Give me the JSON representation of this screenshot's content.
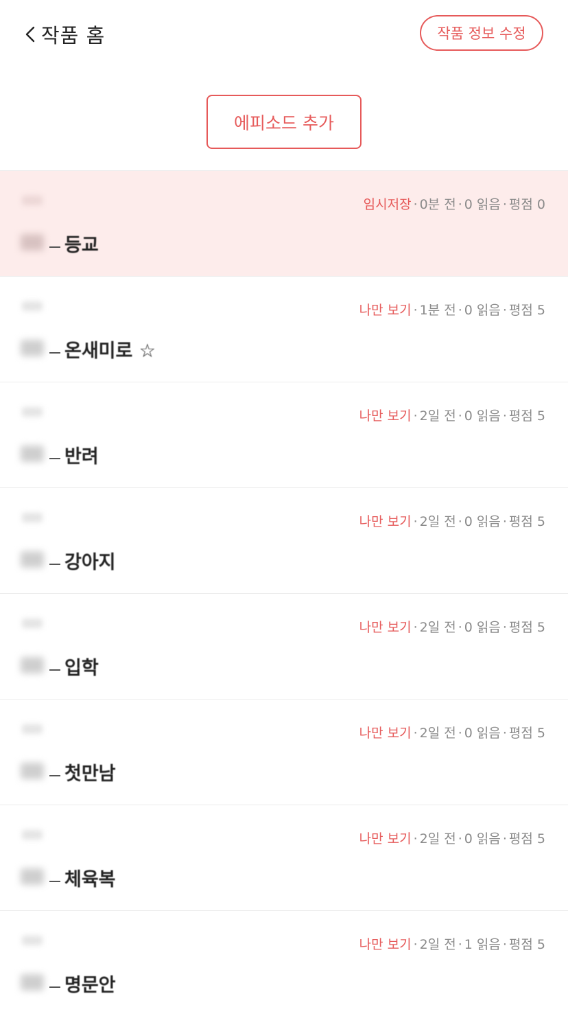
{
  "header": {
    "back_label": "작품 홈",
    "edit_info_label": "작품 정보 수정"
  },
  "actions": {
    "add_episode_label": "에피소드 추가"
  },
  "colors": {
    "accent": "#e65a5a",
    "highlight_bg": "#fdeceb",
    "meta_gray": "#8a8a8a"
  },
  "episodes": [
    {
      "title": "등교",
      "status": "임시저장",
      "time": "0분 전",
      "reads": "0 읽음",
      "rating": "평점 0"
    },
    {
      "title": "온새미로 ☆",
      "status": "나만 보기",
      "time": "1분 전",
      "reads": "0 읽음",
      "rating": "평점 5"
    },
    {
      "title": "반려",
      "status": "나만 보기",
      "time": "2일 전",
      "reads": "0 읽음",
      "rating": "평점 5"
    },
    {
      "title": "강아지",
      "status": "나만 보기",
      "time": "2일 전",
      "reads": "0 읽음",
      "rating": "평점 5"
    },
    {
      "title": "입학",
      "status": "나만 보기",
      "time": "2일 전",
      "reads": "0 읽음",
      "rating": "평점 5"
    },
    {
      "title": "첫만남",
      "status": "나만 보기",
      "time": "2일 전",
      "reads": "0 읽음",
      "rating": "평점 5"
    },
    {
      "title": "체육복",
      "status": "나만 보기",
      "time": "2일 전",
      "reads": "0 읽음",
      "rating": "평점 5"
    },
    {
      "title": "명문안",
      "status": "나만 보기",
      "time": "2일 전",
      "reads": "1 읽음",
      "rating": "평점 5"
    }
  ]
}
